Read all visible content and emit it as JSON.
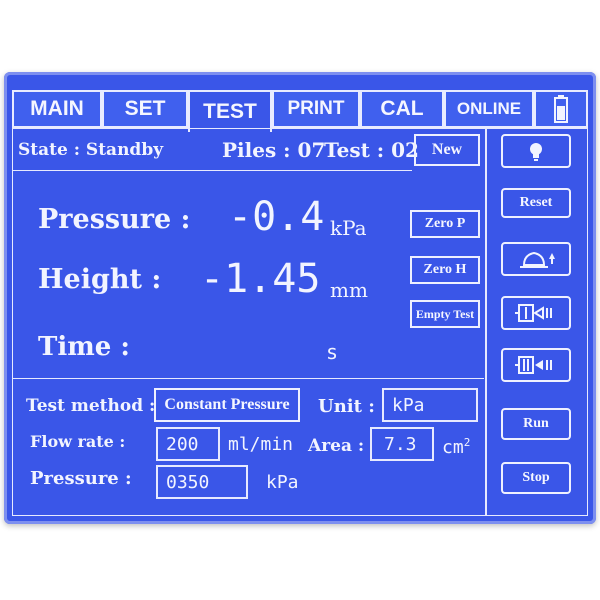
{
  "tabs": [
    {
      "label": "MAIN"
    },
    {
      "label": "SET"
    },
    {
      "label": "TEST"
    },
    {
      "label": "PRINT"
    },
    {
      "label": "CAL"
    },
    {
      "label": "ONLINE"
    }
  ],
  "status": {
    "state": "State : Standby",
    "piles": "Piles : 07",
    "test": "Test : 02",
    "new_label": "New"
  },
  "readings": {
    "pressure_label": "Pressure :",
    "pressure_value": "-0.4",
    "pressure_unit": "kPa",
    "height_label": "Height :",
    "height_value": "-1.45",
    "height_unit": "mm",
    "time_label": "Time :",
    "time_unit": "s"
  },
  "actions": {
    "zero_p": "Zero P",
    "zero_h": "Zero H",
    "empty_test": "Empty Test"
  },
  "settings": {
    "method_label": "Test method :",
    "method_value": "Constant Pressure",
    "unit_label": "Unit :",
    "unit_value": "kPa",
    "flow_label": "Flow rate :",
    "flow_value": "200",
    "flow_unit": "ml/min",
    "area_label": "Area :",
    "area_value": "7.3",
    "area_unit": "cm",
    "area_exp": "2",
    "pressure_label": "Pressure :",
    "pressure_value": "0350",
    "pressure_unit": "kPa"
  },
  "side": {
    "reset": "Reset",
    "run": "Run",
    "stop": "Stop"
  },
  "colors": {
    "panel": "#3a56e8",
    "text": "#f2f4ff"
  }
}
